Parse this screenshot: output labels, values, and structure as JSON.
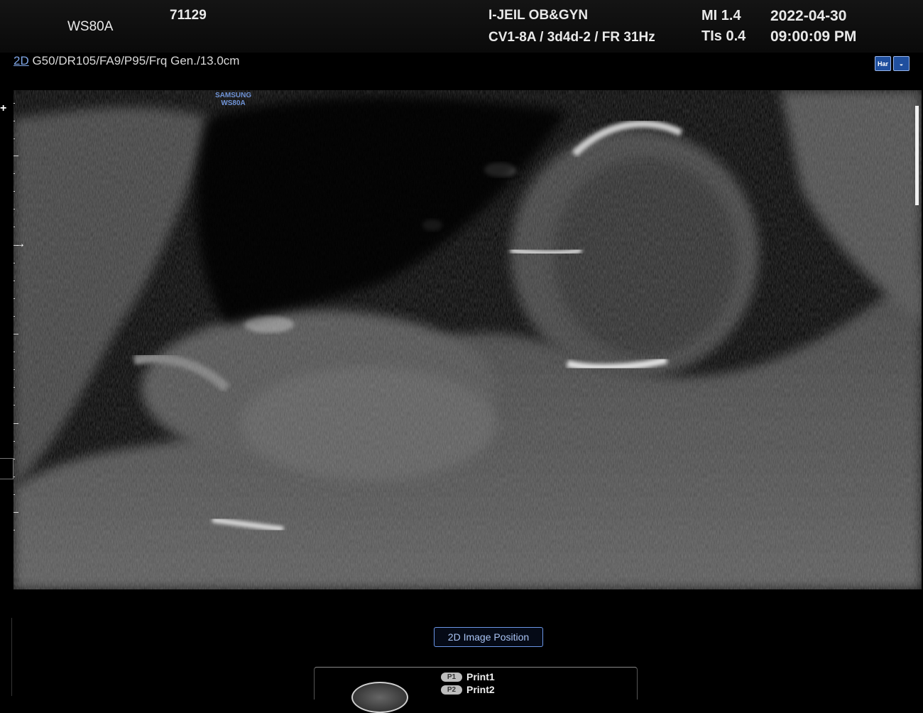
{
  "header": {
    "model": "WS80A",
    "patient_id": "71129",
    "hospital": "I-JEIL OB&GYN",
    "probe_info": "CV1-8A / 3d4d-2 / FR 31Hz",
    "mi": "MI  1.4",
    "tis": "TIs 0.4",
    "date": "2022-04-30",
    "time": "09:00:09 PM"
  },
  "params": {
    "mode": "2D",
    "settings": " G50/DR105/FA9/P95/Frq Gen./13.0cm"
  },
  "toolbar": {
    "har_label": "Har",
    "view_label": "◒"
  },
  "image": {
    "watermark_brand": "SAMSUNG",
    "watermark_model": "WS80A"
  },
  "controls": {
    "position_button": "2D Image Position",
    "print1_badge": "P1",
    "print1_label": "Print1",
    "print2_badge": "P2",
    "print2_label": "Print2"
  },
  "colors": {
    "accent": "#6b96e6",
    "background": "#000000"
  }
}
